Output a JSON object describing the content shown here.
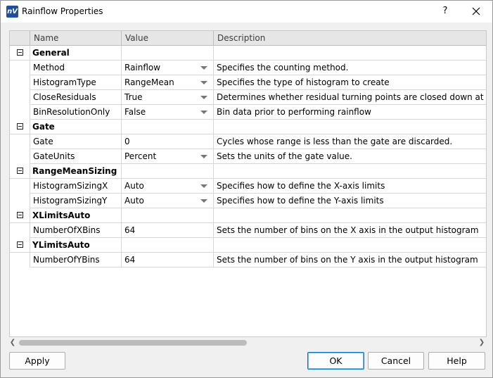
{
  "window": {
    "title": "Rainflow Properties",
    "help_label": "?",
    "icon_label": "nV"
  },
  "grid": {
    "columns": [
      "Name",
      "Value",
      "Description"
    ],
    "rows": [
      {
        "type": "category",
        "name": "General"
      },
      {
        "type": "prop",
        "name": "Method",
        "value": "Rainflow",
        "dropdown": true,
        "desc": "Specifies the counting method."
      },
      {
        "type": "prop",
        "name": "HistogramType",
        "value": "RangeMean",
        "dropdown": true,
        "desc": "Specifies the type of histogram to create"
      },
      {
        "type": "prop",
        "name": "CloseResiduals",
        "value": "True",
        "dropdown": true,
        "desc": "Determines whether residual turning points are closed down at the er"
      },
      {
        "type": "prop",
        "name": "BinResolutionOnly",
        "value": "False",
        "dropdown": true,
        "desc": "Bin data prior to performing rainflow"
      },
      {
        "type": "category",
        "name": "Gate"
      },
      {
        "type": "prop",
        "name": "Gate",
        "value": "0",
        "dropdown": false,
        "desc": "Cycles whose range is less than the gate are discarded."
      },
      {
        "type": "prop",
        "name": "GateUnits",
        "value": "Percent",
        "dropdown": true,
        "desc": "Sets the units of the gate value."
      },
      {
        "type": "category",
        "name": "RangeMeanSizing"
      },
      {
        "type": "prop",
        "name": "HistogramSizingX",
        "value": "Auto",
        "dropdown": true,
        "desc": "Specifies how to define the X-axis limits"
      },
      {
        "type": "prop",
        "name": "HistogramSizingY",
        "value": "Auto",
        "dropdown": true,
        "desc": "Specifies how to define the Y-axis limits"
      },
      {
        "type": "category",
        "name": "XLimitsAuto"
      },
      {
        "type": "prop",
        "name": "NumberOfXBins",
        "value": "64",
        "dropdown": false,
        "desc": "Sets the number of bins on the X axis in the output histogram"
      },
      {
        "type": "category",
        "name": "YLimitsAuto"
      },
      {
        "type": "prop",
        "name": "NumberOfYBins",
        "value": "64",
        "dropdown": false,
        "desc": "Sets the number of bins on the Y axis in the output histogram"
      }
    ]
  },
  "scroll": {
    "left_arrow": "❮",
    "right_arrow": "❯"
  },
  "buttons": {
    "apply": "Apply",
    "ok": "OK",
    "cancel": "Cancel",
    "help": "Help"
  }
}
